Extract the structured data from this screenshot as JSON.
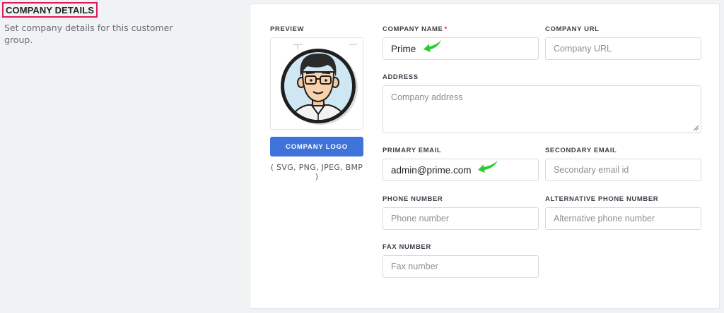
{
  "section": {
    "title": "COMPANY DETAILS",
    "description": "Set company details for this customer group."
  },
  "preview": {
    "label": "PREVIEW",
    "logo_button": "COMPANY LOGO",
    "formats": "( SVG, PNG, JPEG, BMP )",
    "image_icon": "avatar-man-with-glasses-icon"
  },
  "form": {
    "company_name": {
      "label": "COMPANY NAME",
      "required": "*",
      "value": "Prime"
    },
    "company_url": {
      "label": "COMPANY URL",
      "placeholder": "Company URL"
    },
    "address": {
      "label": "ADDRESS",
      "placeholder": "Company address"
    },
    "primary_email": {
      "label": "PRIMARY EMAIL",
      "value": "admin@prime.com"
    },
    "secondary_email": {
      "label": "SECONDARY EMAIL",
      "placeholder": "Secondary email id"
    },
    "phone": {
      "label": "PHONE NUMBER",
      "placeholder": "Phone number"
    },
    "alt_phone": {
      "label": "ALTERNATIVE PHONE NUMBER",
      "placeholder": "Alternative phone number"
    },
    "fax": {
      "label": "FAX NUMBER",
      "placeholder": "Fax number"
    }
  },
  "colors": {
    "primary_button": "#3f73d9",
    "highlight_border": "#e0195a",
    "annotation_arrow": "#2dcc2d",
    "required_mark": "#e0195a"
  }
}
